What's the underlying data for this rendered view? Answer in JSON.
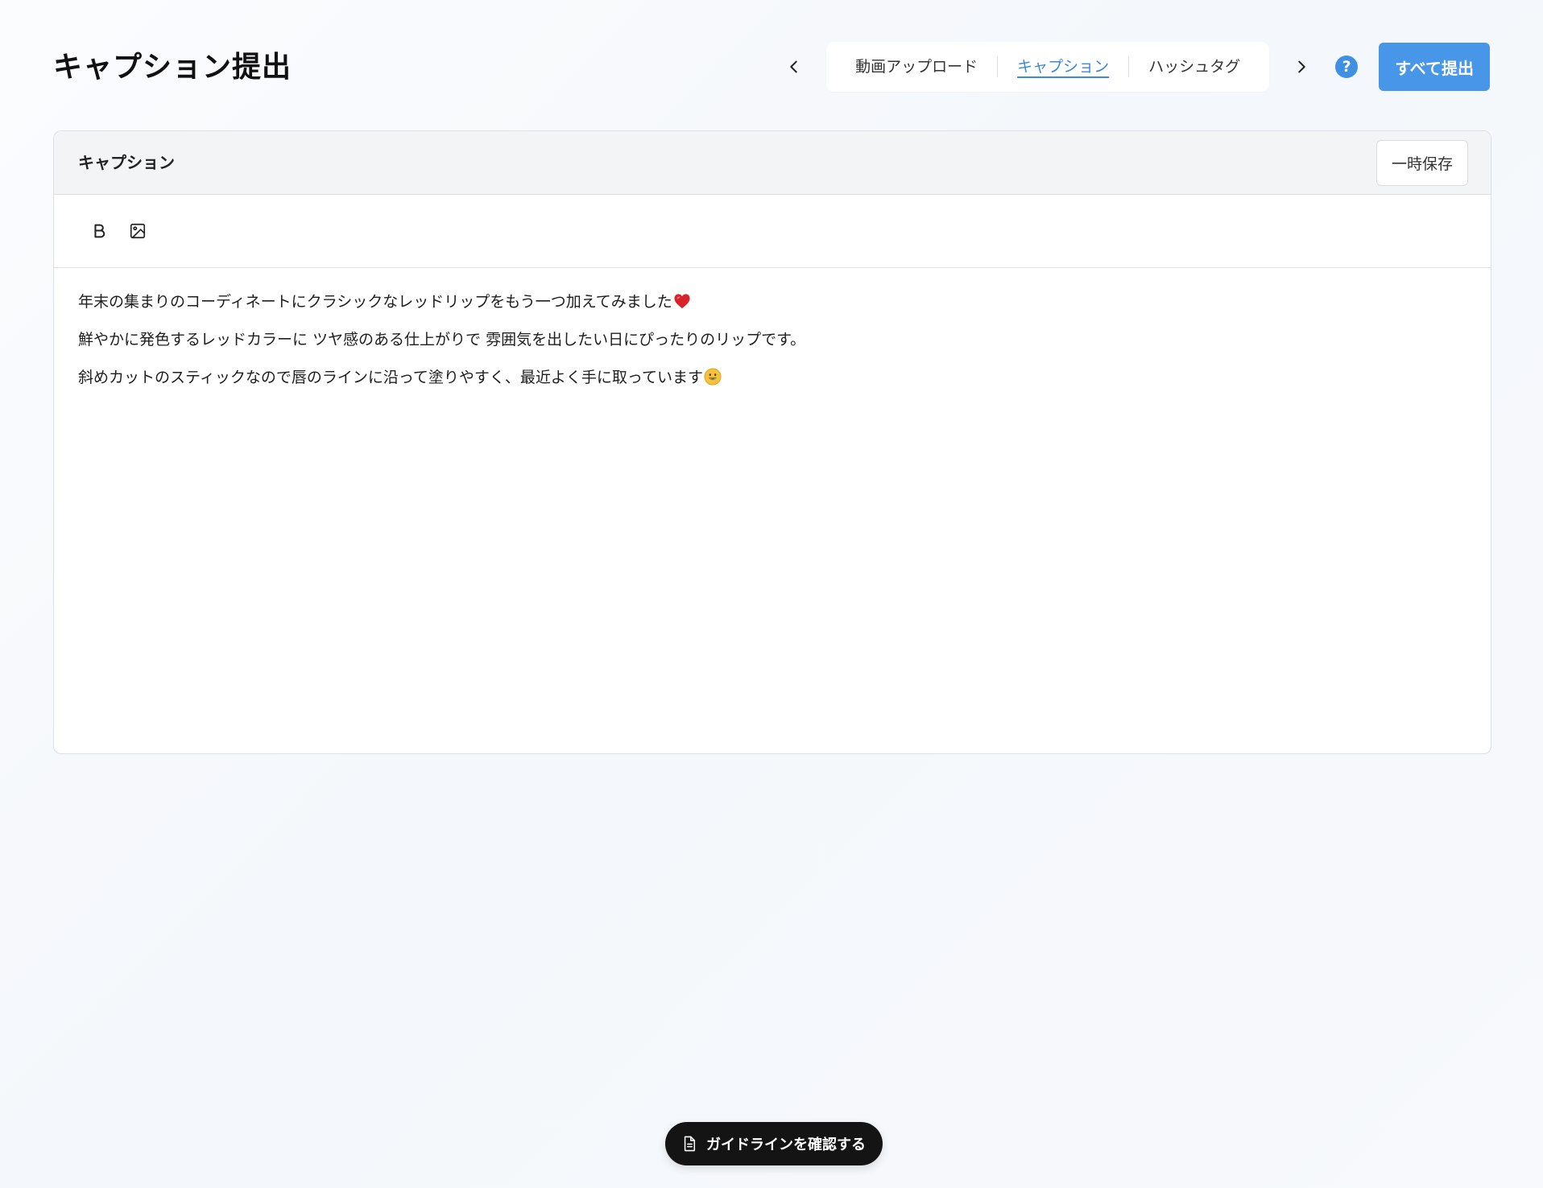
{
  "page": {
    "title": "キャプション提出"
  },
  "steps": {
    "items": [
      {
        "label": "動画アップロード",
        "active": false
      },
      {
        "label": "キャプション",
        "active": true
      },
      {
        "label": "ハッシュタグ",
        "active": false
      }
    ]
  },
  "header": {
    "help_label": "?",
    "submit_all_label": "すべて提出"
  },
  "card": {
    "title": "キャプション",
    "save_draft_label": "一時保存",
    "toolbar": {
      "bold_label": "B",
      "icons": [
        "bold-icon",
        "image-icon"
      ]
    },
    "lines": [
      "年末の集まりのコーディネートにクラシックなレッドリップをもう一つ加えてみました",
      "鮮やかに発色するレッドカラーに ツヤ感のある仕上がりで 雰囲気を出したい日にぴったりのリップです。",
      "斜めカットのスティックなので唇のラインに沿って塗りやすく、最近よく手に取っています"
    ],
    "emojis": [
      "heart-emoji",
      "smile-emoji"
    ]
  },
  "guideline": {
    "label": "ガイドラインを確認する",
    "icon": "document-icon"
  },
  "colors": {
    "accent": "#4796e8",
    "active_step": "#3b87d9",
    "help": "#3f8fe2",
    "pill_bg": "#141414"
  }
}
